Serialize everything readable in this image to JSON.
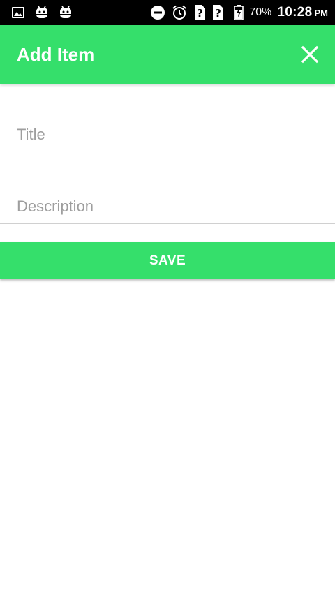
{
  "status_bar": {
    "left_icons": [
      "image-notification-icon",
      "android-notification-icon",
      "android-notification-icon"
    ],
    "right_icons": [
      "do-not-disturb-icon",
      "alarm-icon",
      "unknown-sim-icon",
      "unknown-sim-icon",
      "battery-charging-icon"
    ],
    "battery_percent": "70%",
    "time": "10:28",
    "ampm": "PM"
  },
  "app_bar": {
    "title": "Add Item",
    "close_icon": "close-icon",
    "color": "#35df6b"
  },
  "form": {
    "title": {
      "value": "",
      "placeholder": "Title"
    },
    "description": {
      "value": "",
      "placeholder": "Description"
    },
    "save_label": "SAVE"
  },
  "colors": {
    "accent": "#35df6b",
    "status_bar": "#000000",
    "hint_text": "#9e9e9e"
  }
}
